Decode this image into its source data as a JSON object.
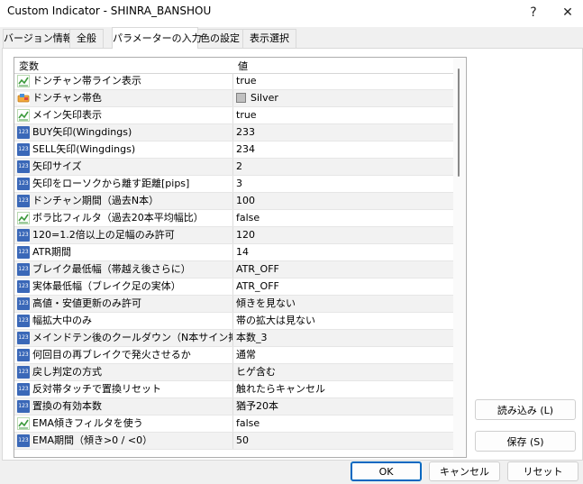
{
  "window": {
    "title": "Custom Indicator - SHINRA_BANSHOU",
    "help": "?",
    "close": "✕"
  },
  "tabs": [
    "バージョン情報",
    "全般",
    "パラメーターの入力",
    "色の設定",
    "表示選択"
  ],
  "grid": {
    "header_variable": "変数",
    "header_value": "値",
    "rows": [
      {
        "name": "ドンチャン帯ライン表示",
        "value": "true",
        "type": "bool"
      },
      {
        "name": "ドンチャン帯色",
        "value": "Silver",
        "type": "color",
        "swatch": "#c0c0c0"
      },
      {
        "name": "メイン矢印表示",
        "value": "true",
        "type": "bool"
      },
      {
        "name": "BUY矢印(Wingdings)",
        "value": "233",
        "type": "num"
      },
      {
        "name": "SELL矢印(Wingdings)",
        "value": "234",
        "type": "num"
      },
      {
        "name": "矢印サイズ",
        "value": "2",
        "type": "num"
      },
      {
        "name": "矢印をローソクから離す距離[pips]",
        "value": "3",
        "type": "num"
      },
      {
        "name": "ドンチャン期間（過去N本）",
        "value": "100",
        "type": "num"
      },
      {
        "name": "ボラ比フィルタ（過去20本平均幅比）",
        "value": "false",
        "type": "bool"
      },
      {
        "name": "120=1.2倍以上の足幅のみ許可",
        "value": "120",
        "type": "num"
      },
      {
        "name": "ATR期間",
        "value": "14",
        "type": "num"
      },
      {
        "name": "ブレイク最低幅（帯越え後さらに）",
        "value": "ATR_OFF",
        "type": "num"
      },
      {
        "name": "実体最低幅（ブレイク足の実体）",
        "value": "ATR_OFF",
        "type": "num"
      },
      {
        "name": "高値・安値更新のみ許可",
        "value": "傾きを見ない",
        "type": "num"
      },
      {
        "name": "幅拡大中のみ",
        "value": "帯の拡大は見ない",
        "type": "num"
      },
      {
        "name": "メインドテン後のクールダウン（N本サイン抑止）",
        "value": "本数_3",
        "type": "num"
      },
      {
        "name": "何回目の再ブレイクで発火させるか",
        "value": "通常",
        "type": "num"
      },
      {
        "name": "戻し判定の方式",
        "value": "ヒゲ含む",
        "type": "num"
      },
      {
        "name": "反対帯タッチで置換リセット",
        "value": "触れたらキャンセル",
        "type": "num"
      },
      {
        "name": "置換の有効本数",
        "value": "猶予20本",
        "type": "num"
      },
      {
        "name": "EMA傾きフィルタを使う",
        "value": "false",
        "type": "bool"
      },
      {
        "name": "EMA期間（傾き>0 / <0）",
        "value": "50",
        "type": "num"
      }
    ]
  },
  "side_buttons": {
    "load": "読み込み (L)",
    "save": "保存 (S)"
  },
  "footer": {
    "ok": "OK",
    "cancel": "キャンセル",
    "reset": "リセット"
  },
  "colors": {
    "accent": "#0067c0",
    "num_icon": "#3a68b8"
  }
}
